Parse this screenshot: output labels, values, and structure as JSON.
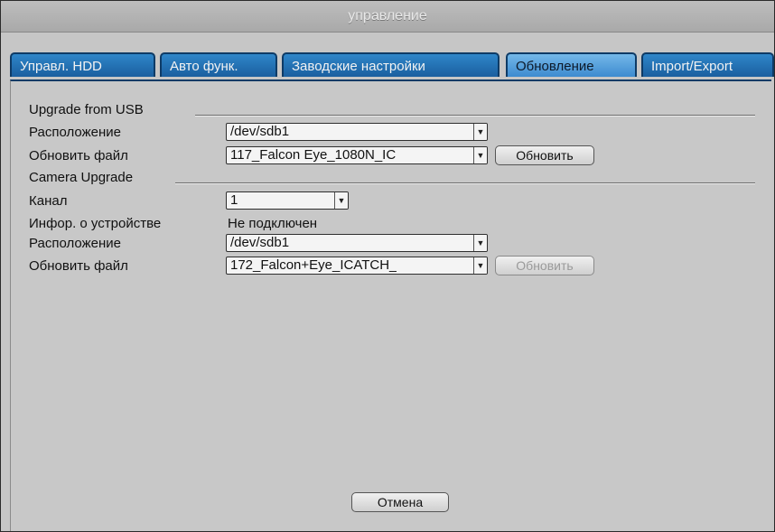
{
  "window": {
    "title": "управление"
  },
  "tabs": [
    {
      "label": "Управл. HDD"
    },
    {
      "label": "Авто функ."
    },
    {
      "label": "Заводские настройки"
    },
    {
      "label": "Обновление",
      "active": true
    },
    {
      "label": "Import/Export"
    }
  ],
  "usb": {
    "section_title": "Upgrade from USB",
    "location_label": "Расположение",
    "location_value": "/dev/sdb1",
    "file_label": "Обновить файл",
    "file_value": "117_Falcon Eye_1080N_IC",
    "update_button": "Обновить"
  },
  "camera": {
    "section_title": "Camera Upgrade",
    "channel_label": "Канал",
    "channel_value": "1",
    "device_info_label": "Инфор. о устройстве",
    "device_info_value": "Не подключен",
    "location_label": "Расположение",
    "location_value": "/dev/sdb1",
    "file_label": "Обновить файл",
    "file_value": "172_Falcon+Eye_ICATCH_",
    "update_button": "Обновить",
    "update_enabled": false
  },
  "footer": {
    "cancel_button": "Отмена"
  },
  "colors": {
    "tab_blue": "#1a5f9f",
    "tab_active": "#74b8e8",
    "panel_gray": "#c8c8c8"
  }
}
